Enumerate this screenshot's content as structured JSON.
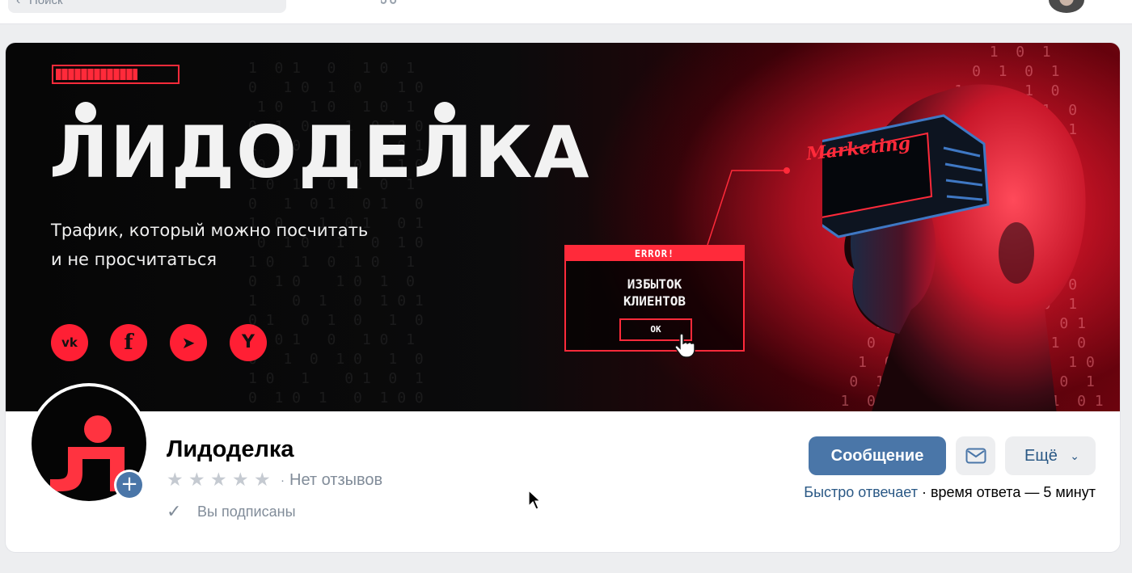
{
  "header": {
    "search_placeholder": "Поиск",
    "icons": [
      "chevron-left-icon",
      "bell-icon",
      "music-icon"
    ]
  },
  "cover": {
    "brand": "ЛИДОДЕЛКА",
    "tagline_line1": "Трафик, который можно посчитать",
    "tagline_line2": "и не просчитаться",
    "progress": 0.68,
    "social": [
      {
        "name": "vk",
        "glyph": "vk"
      },
      {
        "name": "facebook",
        "glyph": "f"
      },
      {
        "name": "telegram",
        "glyph": "➤"
      },
      {
        "name": "yandex",
        "glyph": "Y"
      }
    ],
    "error_title": "ERROR!",
    "error_line1": "ИЗБЫТОК",
    "error_line2": "КЛИЕНТОВ",
    "error_ok": "OK",
    "marketing": "Marketing"
  },
  "profile": {
    "name": "Лидоделка",
    "stars": 5,
    "rating_separator": "·",
    "reviews": "Нет отзывов",
    "subscribed": "Вы подписаны",
    "message_button": "Сообщение",
    "more_button": "Ещё",
    "response_fast": "Быстро отвечает",
    "response_rest": " · время ответа — 5 минут"
  },
  "colors": {
    "accent": "#4a76a8",
    "link": "#2a5885",
    "brand_red": "#ff2a3a",
    "muted": "#818c99"
  }
}
